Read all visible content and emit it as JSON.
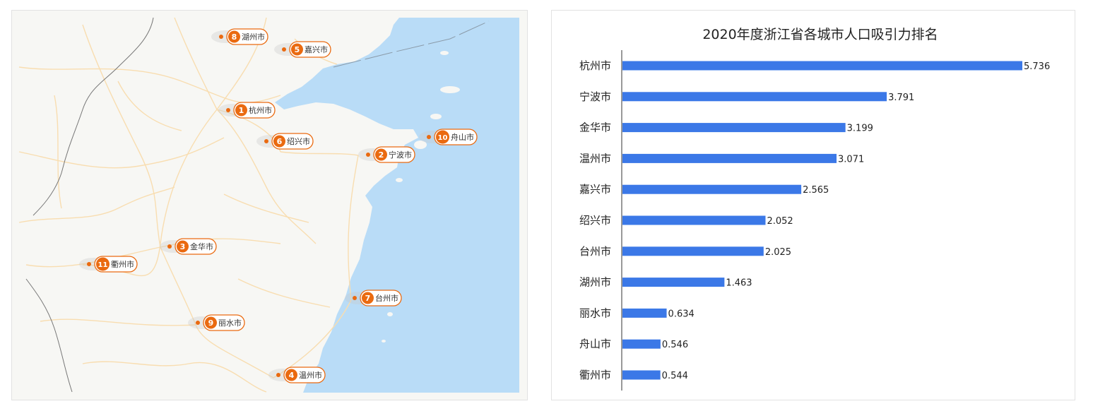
{
  "map": {
    "markers": [
      {
        "rank": "1",
        "name": "杭州市"
      },
      {
        "rank": "2",
        "name": "宁波市"
      },
      {
        "rank": "3",
        "name": "金华市"
      },
      {
        "rank": "4",
        "name": "温州市"
      },
      {
        "rank": "5",
        "name": "嘉兴市"
      },
      {
        "rank": "6",
        "name": "绍兴市"
      },
      {
        "rank": "7",
        "name": "台州市"
      },
      {
        "rank": "8",
        "name": "湖州市"
      },
      {
        "rank": "9",
        "name": "丽水市"
      },
      {
        "rank": "10",
        "name": "舟山市"
      },
      {
        "rank": "11",
        "name": "衢州市"
      }
    ],
    "colors": {
      "sea": "#b9dcf7",
      "land": "#f7f7f4",
      "road": "#f8ddb0",
      "marker": "#ea6a10"
    }
  },
  "chart_data": {
    "type": "bar",
    "orientation": "horizontal",
    "title": "2020年度浙江省各城市人口吸引力排名",
    "categories": [
      "杭州市",
      "宁波市",
      "金华市",
      "温州市",
      "嘉兴市",
      "绍兴市",
      "台州市",
      "湖州市",
      "丽水市",
      "舟山市",
      "衢州市"
    ],
    "values": [
      5.736,
      3.791,
      3.199,
      3.071,
      2.565,
      2.052,
      2.025,
      1.463,
      0.634,
      0.546,
      0.544
    ],
    "data_labels": [
      "5.736",
      "3.791",
      "3.199",
      "3.071",
      "2.565",
      "2.052",
      "2.025",
      "1.463",
      "0.634",
      "0.546",
      "0.544"
    ],
    "xlim": [
      0,
      5.736
    ],
    "grid": false,
    "bar_color": "#3b78e7"
  }
}
